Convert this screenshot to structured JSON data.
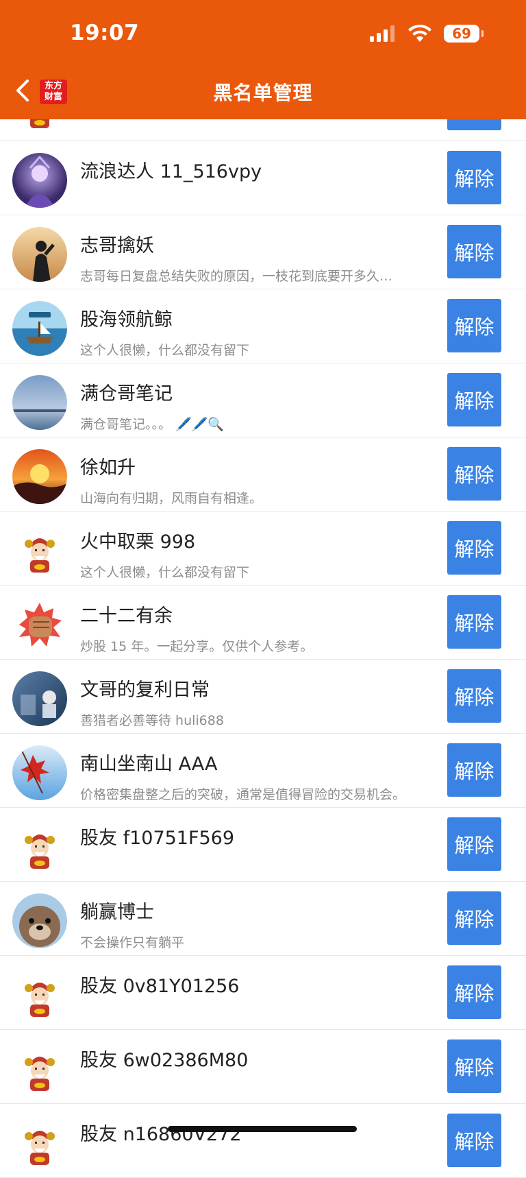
{
  "status": {
    "time": "19:07",
    "battery": "69"
  },
  "header": {
    "title": "黑名单管理",
    "logo_line1": "东方",
    "logo_line2": "财富"
  },
  "unblock_label": "解除",
  "rows": [
    {
      "name": "",
      "bio": "",
      "avatar": "mascot"
    },
    {
      "name": "流浪达人 11_516vpy",
      "bio": "",
      "avatar": "purple-warrior"
    },
    {
      "name": "志哥擒妖",
      "bio": "志哥每日复盘总结失败的原因，一枝花到底要开多久…",
      "avatar": "silhouette"
    },
    {
      "name": "股海领航鲸",
      "bio": "这个人很懒，什么都没有留下",
      "avatar": "sea-ship"
    },
    {
      "name": "满仓哥笔记",
      "bio": "满仓哥笔记。。。 🖊️🖊️🔍",
      "avatar": "sky-sea"
    },
    {
      "name": "徐如升",
      "bio": "山海向有归期，风雨自有相逢。",
      "avatar": "sunset"
    },
    {
      "name": "火中取栗 998",
      "bio": "这个人很懒，什么都没有留下",
      "avatar": "mascot"
    },
    {
      "name": "二十二有余",
      "bio": "炒股 15 年。一起分享。仅供个人参考。",
      "avatar": "fist"
    },
    {
      "name": "文哥的复利日常",
      "bio": "善猎者必善等待 huli688",
      "avatar": "blue-photo"
    },
    {
      "name": "南山坐南山 AAA",
      "bio": "价格密集盘整之后的突破，通常是值得冒险的交易机会。",
      "avatar": "red-leaves"
    },
    {
      "name": "股友 f10751F569",
      "bio": "",
      "avatar": "mascot"
    },
    {
      "name": "躺赢博士",
      "bio": "不会操作只有躺平",
      "avatar": "otter"
    },
    {
      "name": "股友 0v81Y01256",
      "bio": "",
      "avatar": "mascot"
    },
    {
      "name": "股友 6w02386M80",
      "bio": "",
      "avatar": "mascot"
    },
    {
      "name": "股友 n16860V272",
      "bio": "",
      "avatar": "mascot"
    }
  ]
}
